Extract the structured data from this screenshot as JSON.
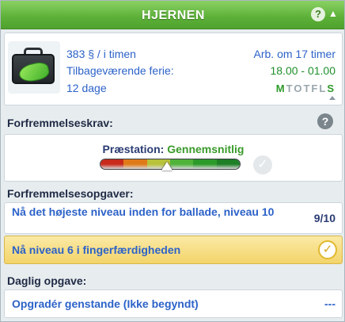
{
  "header": {
    "title": "Hjernen",
    "help_label": "?",
    "collapse_label": "▲"
  },
  "job": {
    "icon": "briefcase-money-icon",
    "salary": "383 § / i timen",
    "vacation_label": "Tilbageværende ferie:",
    "vacation_days": "12 dage",
    "work_in": "Arb. om 17 timer",
    "hours": "18.00 - 01.00",
    "work_days": [
      {
        "letter": "M",
        "active": true
      },
      {
        "letter": "T",
        "active": false
      },
      {
        "letter": "O",
        "active": false
      },
      {
        "letter": "T",
        "active": false
      },
      {
        "letter": "F",
        "active": false
      },
      {
        "letter": "L",
        "active": false
      },
      {
        "letter": "S",
        "active": true
      }
    ]
  },
  "requirements": {
    "heading": "Forfremmelseskrav:",
    "help_label": "?",
    "performance_label": "Præstation:",
    "performance_value": "Gennemsnitlig",
    "performance_level": 0.48,
    "bar_colors": [
      "#c82a1c",
      "#e07a18",
      "#b8c23a",
      "#4fb33a",
      "#2c9a2a",
      "#1e7f26"
    ],
    "check_label": "✓"
  },
  "tasks": {
    "heading": "Forfremmelsesopgaver:",
    "items": [
      {
        "text": "Nå det højeste niveau inden for ballade, niveau 10",
        "value": "9/10",
        "done": false
      },
      {
        "text": "Nå niveau 6 i fingerfærdigheden",
        "value": "✓",
        "done": true
      }
    ]
  },
  "daily": {
    "heading": "Daglig opgave:",
    "text": "Opgradér genstande (Ikke begyndt)",
    "value": "---"
  },
  "colors": {
    "header_green": "#5cb038",
    "link_blue": "#2c62c8",
    "done_yellow": "#f3d46a"
  }
}
